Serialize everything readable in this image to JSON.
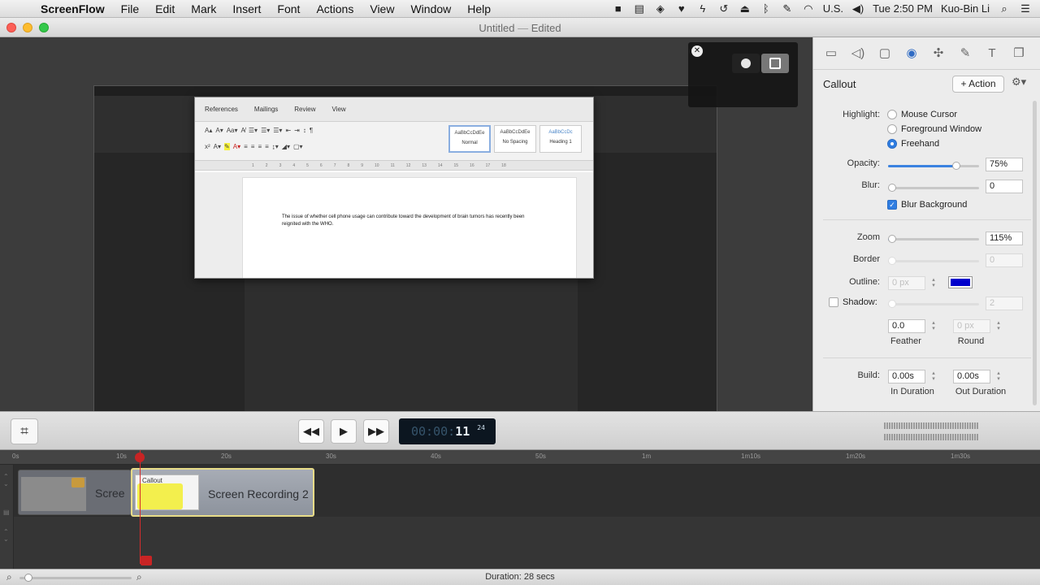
{
  "menubar": {
    "apple": "",
    "items": [
      "ScreenFlow",
      "File",
      "Edit",
      "Mark",
      "Insert",
      "Font",
      "Actions",
      "View",
      "Window",
      "Help"
    ],
    "status_input": "U.S.",
    "clock": "Tue 2:50 PM",
    "user": "Kuo-Bin Li"
  },
  "window": {
    "title": "Untitled",
    "separator": "—",
    "state": "Edited"
  },
  "word_doc": {
    "tabs": [
      "References",
      "Mailings",
      "Review",
      "View"
    ],
    "styles": [
      {
        "sample": "AaBbCcDdEe",
        "name": "Normal"
      },
      {
        "sample": "AaBbCcDdEe",
        "name": "No Spacing"
      },
      {
        "sample": "AaBbCcDc",
        "name": "Heading 1"
      }
    ],
    "ruler_marks": [
      "1",
      "2",
      "3",
      "4",
      "5",
      "6",
      "7",
      "8",
      "9",
      "10",
      "11",
      "12",
      "13",
      "14",
      "15",
      "16",
      "17",
      "18"
    ],
    "body_text": "The issue of whether cell phone usage can contribute toward the development of brain tumors has recently been reignited with the WHO."
  },
  "inspector": {
    "toolbar_icons": [
      "video-icon",
      "audio-icon",
      "screen-icon",
      "callout-icon",
      "touch-icon",
      "annotation-icon",
      "text-icon",
      "media-library-icon"
    ],
    "heading": "Callout",
    "action_button": "+ Action",
    "highlight": {
      "label": "Highlight:",
      "options": [
        "Mouse Cursor",
        "Foreground Window",
        "Freehand"
      ],
      "selected": "Freehand"
    },
    "opacity": {
      "label": "Opacity:",
      "value": "75%",
      "level": 0.75
    },
    "blur": {
      "label": "Blur:",
      "value": "0",
      "level": 0
    },
    "blur_background": {
      "label": "Blur Background",
      "checked": true
    },
    "zoom": {
      "label": "Zoom",
      "value": "115%",
      "level": 0.02
    },
    "border": {
      "label": "Border",
      "value": "0"
    },
    "outline": {
      "label": "Outline:",
      "value": "0 px",
      "color": "#0000cc"
    },
    "shadow": {
      "label": "Shadow:",
      "value": "2",
      "checked": false
    },
    "feather": {
      "value": "0.0",
      "label": "Feather"
    },
    "round": {
      "value": "0 px",
      "label": "Round"
    },
    "build": {
      "label": "Build:",
      "in_value": "0.00s",
      "in_label": "In Duration",
      "out_value": "0.00s",
      "out_label": "Out Duration"
    }
  },
  "transport": {
    "timecode_dim": "00:00:",
    "timecode_now": "11",
    "timecode_frames": "24"
  },
  "timeline": {
    "ticks": [
      "0s",
      "10s",
      "20s",
      "30s",
      "40s",
      "50s",
      "1m",
      "1m10s",
      "1m20s",
      "1m30s"
    ],
    "clips": [
      {
        "title": "Scree"
      },
      {
        "title": "Screen Recording 2",
        "callout_label": "Callout"
      }
    ]
  },
  "status_bar": {
    "duration": "Duration: 28 secs"
  }
}
